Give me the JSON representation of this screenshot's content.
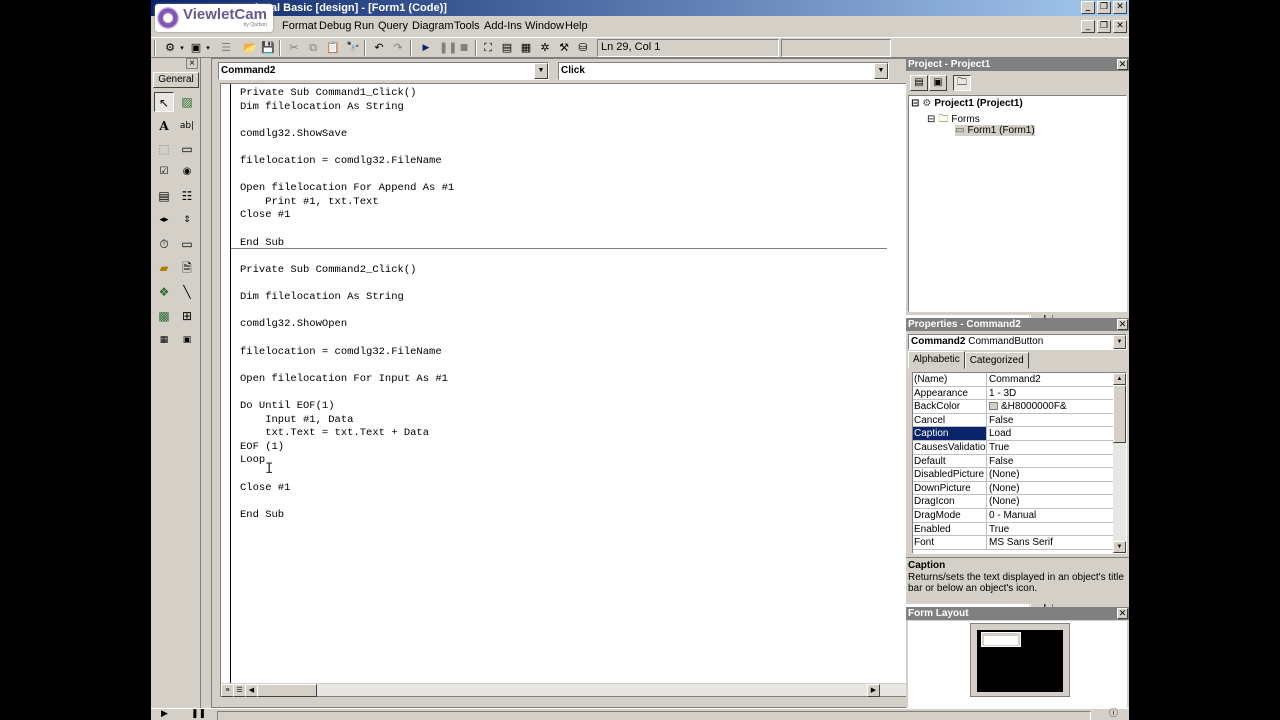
{
  "window": {
    "title": "isual Basic [design] - [Form1 (Code)]"
  },
  "watermark": {
    "brand": "ViewletCam",
    "sub": "by Qarbon"
  },
  "menu": {
    "items": [
      "Format",
      "Debug",
      "Run",
      "Query",
      "Diagram",
      "Tools",
      "Add-Ins",
      "Window",
      "Help"
    ]
  },
  "toolbar": {
    "position_status": "Ln 29, Col 1"
  },
  "toolbox": {
    "tab_label": "General"
  },
  "code_window": {
    "object_combo": "Command2",
    "procedure_combo": "Click",
    "lines_proc1": [
      "Private Sub Command1_Click()",
      "Dim filelocation As String",
      "",
      "comdlg32.ShowSave",
      "",
      "filelocation = comdlg32.FileName",
      "",
      "Open filelocation For Append As #1",
      "    Print #1, txt.Text",
      "Close #1",
      "",
      "End Sub"
    ],
    "lines_proc2": [
      "Private Sub Command2_Click()",
      "",
      "Dim filelocation As String",
      "",
      "comdlg32.ShowOpen",
      "",
      "filelocation = comdlg32.FileName",
      "",
      "Open filelocation For Input As #1",
      "",
      "Do Until EOF(1)",
      "    Input #1, Data",
      "    txt.Text = txt.Text + Data",
      "EOF (1)",
      "Loop",
      "",
      "Close #1",
      "",
      "End Sub"
    ]
  },
  "project_panel": {
    "title": "Project - Project1",
    "tree": {
      "root": "Project1 (Project1)",
      "folder": "Forms",
      "form": "Form1 (Form1)"
    }
  },
  "properties_panel": {
    "title": "Properties - Command2",
    "object_name": "Command2",
    "object_type": "CommandButton",
    "tabs": [
      "Alphabetic",
      "Categorized"
    ],
    "active_tab": "Alphabetic",
    "rows": [
      {
        "name": "(Name)",
        "value": "Command2"
      },
      {
        "name": "Appearance",
        "value": "1 - 3D"
      },
      {
        "name": "BackColor",
        "value": "&H8000000F&"
      },
      {
        "name": "Cancel",
        "value": "False"
      },
      {
        "name": "Caption",
        "value": "Load"
      },
      {
        "name": "CausesValidation",
        "value": "True"
      },
      {
        "name": "Default",
        "value": "False"
      },
      {
        "name": "DisabledPicture",
        "value": "(None)"
      },
      {
        "name": "DownPicture",
        "value": "(None)"
      },
      {
        "name": "DragIcon",
        "value": "(None)"
      },
      {
        "name": "DragMode",
        "value": "0 - Manual"
      },
      {
        "name": "Enabled",
        "value": "True"
      },
      {
        "name": "Font",
        "value": "MS Sans Serif"
      }
    ],
    "selected_row": "Caption",
    "description_title": "Caption",
    "description_text": "Returns/sets the text displayed in an object's title bar or below an object's icon."
  },
  "form_layout_panel": {
    "title": "Form Layout"
  },
  "colors": {
    "title_bar": "#0a246a",
    "selection": "#0a246a",
    "face": "#d4d0c8"
  }
}
